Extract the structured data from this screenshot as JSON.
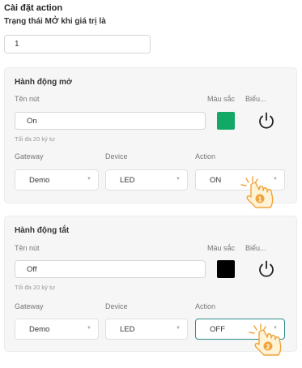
{
  "header": {
    "title": "Cài đặt action",
    "subtitle": "Trạng thái MỞ khi giá trị là",
    "value": "1"
  },
  "labels": {
    "button_name": "Tên nút",
    "color": "Màu sắc",
    "icon": "Biểu...",
    "hint": "Tối đa 20 ký tự",
    "gateway": "Gateway",
    "device": "Device",
    "action": "Action"
  },
  "open_action": {
    "title": "Hành động mở",
    "button_name": "On",
    "color": "#14a866",
    "gateway": "Demo",
    "device": "LED",
    "action": "ON",
    "callout": "1"
  },
  "close_action": {
    "title": "Hành động tắt",
    "button_name": "Off",
    "color": "#000000",
    "gateway": "Demo",
    "device": "LED",
    "action": "OFF",
    "callout": "2"
  },
  "icons": {
    "power": "power-icon",
    "pointer": "hand-pointer-icon",
    "dropdown": "chevron-down-icon"
  }
}
